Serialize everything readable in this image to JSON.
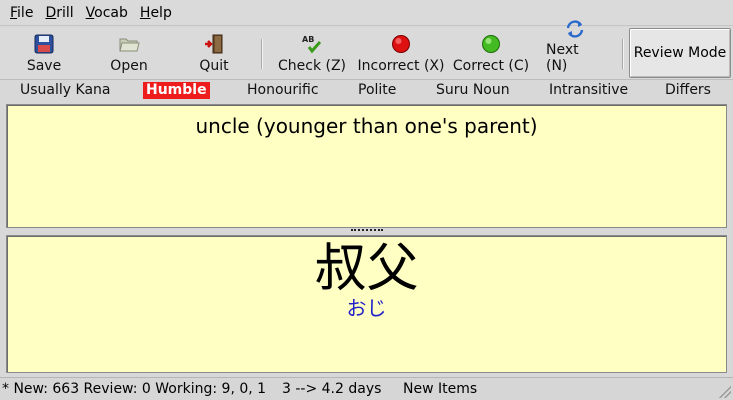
{
  "menu": [
    "File",
    "Drill",
    "Vocab",
    "Help"
  ],
  "toolbar": {
    "save": "Save",
    "open": "Open",
    "quit": "Quit",
    "check": "Check (Z)",
    "incorrect": "Incorrect (X)",
    "correct": "Correct (C)",
    "next": "Next (N)",
    "review_mode": "Review Mode",
    "check_icon_text": "AB"
  },
  "tags": {
    "items": [
      "Usually Kana",
      "Humble",
      "Honourific",
      "Polite",
      "Suru Noun",
      "Intransitive",
      "Differs"
    ],
    "active": "Humble"
  },
  "card": {
    "meaning": "uncle (younger than one's parent)",
    "kanji": "叔父",
    "reading": "おじ"
  },
  "status": {
    "counts": "* New: 663 Review: 0 Working: 9, 0, 1",
    "interval": "3 --> 4.2 days",
    "mode": "New Items"
  },
  "colors": {
    "pane_bg": "#ffffc4",
    "active_tag": "#ee1c1c",
    "reading": "#2222cc",
    "incorrect_icon": "#dd1111",
    "correct_icon": "#44bb22"
  }
}
